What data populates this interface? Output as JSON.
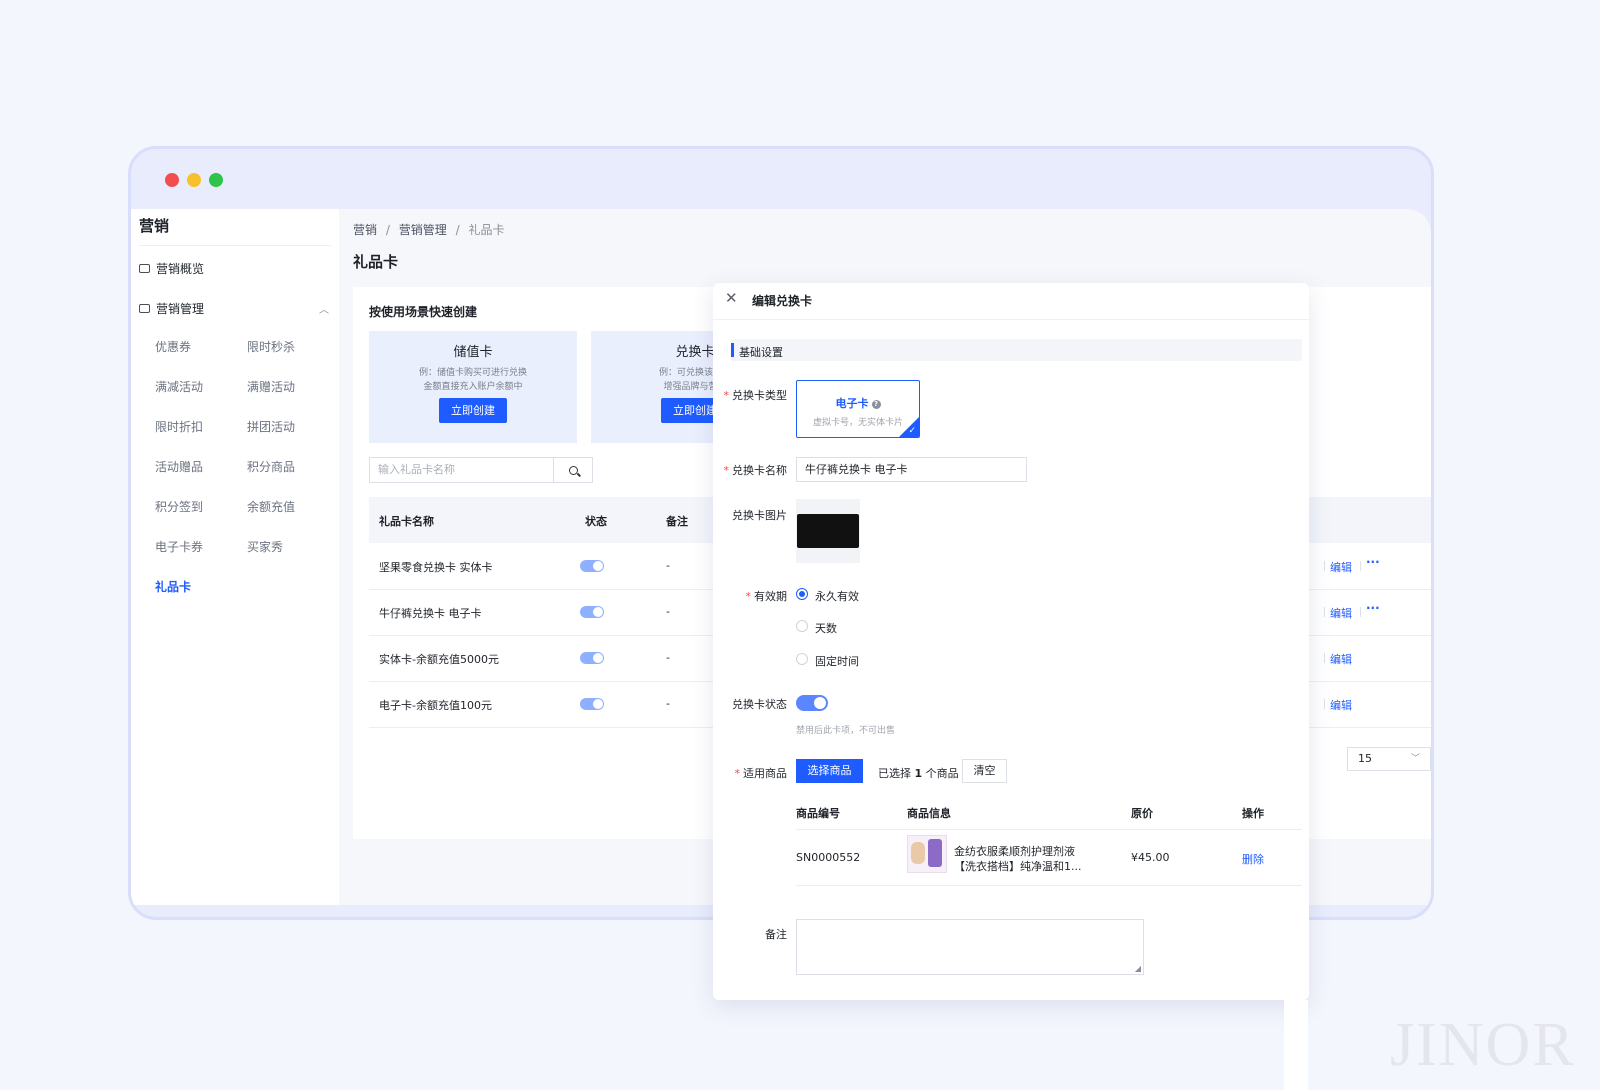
{
  "sidebar": {
    "title": "营销",
    "overview": "营销概览",
    "management": "营销管理",
    "items": [
      "优惠券",
      "限时秒杀",
      "满减活动",
      "满赠活动",
      "限时折扣",
      "拼团活动",
      "活动赠品",
      "积分商品",
      "积分签到",
      "余额充值",
      "电子卡券",
      "买家秀",
      "礼品卡"
    ],
    "active": "礼品卡"
  },
  "breadcrumb": {
    "l1": "营销",
    "l2": "营销管理",
    "l3": "礼品卡",
    "sep": "/"
  },
  "page_title": "礼品卡",
  "quick_create": {
    "title": "按使用场景快速创建",
    "cards": [
      {
        "name": "储值卡",
        "desc1": "例：储值卡购买可进行兑换",
        "desc2": "金额直接充入账户余额中",
        "button": "立即创建"
      },
      {
        "name": "兑换卡",
        "desc1": "例：可兑换该卡绑",
        "desc2": "增强品牌与营销",
        "button": "立即创建"
      }
    ]
  },
  "search": {
    "placeholder": "输入礼品卡名称"
  },
  "table": {
    "headers": {
      "name": "礼品卡名称",
      "status": "状态",
      "remark": "备注"
    },
    "rows": [
      {
        "name": "坚果零食兑换卡 实体卡",
        "remark": "-",
        "edit": "编辑",
        "more": "···"
      },
      {
        "name": "牛仔裤兑换卡 电子卡",
        "remark": "-",
        "edit": "编辑",
        "more": "···"
      },
      {
        "name": "实体卡-余额充值5000元",
        "remark": "-",
        "edit": "编辑"
      },
      {
        "name": "电子卡-余额充值100元",
        "remark": "-",
        "edit": "编辑"
      }
    ],
    "page_size": "15"
  },
  "drawer": {
    "close": "✕",
    "title": "编辑兑换卡",
    "section": "基础设置",
    "type_label": "兑换卡类型",
    "type_name": "电子卡",
    "type_help": "?",
    "type_desc": "虚拟卡号，无实体卡片",
    "type_check": "✓",
    "name_label": "兑换卡名称",
    "name_value": "牛仔裤兑换卡  电子卡",
    "image_label": "兑换卡图片",
    "validity_label": "有效期",
    "validity_options": [
      "永久有效",
      "天数",
      "固定时间"
    ],
    "status_label": "兑换卡状态",
    "status_hint": "禁用后此卡项，不可出售",
    "goods_label": "适用商品",
    "select_goods": "选择商品",
    "selected_prefix": "已选择",
    "selected_count": "1",
    "selected_suffix": "个商品",
    "clear": "清空",
    "product_table": {
      "headers": {
        "code": "商品编号",
        "info": "商品信息",
        "price": "原价",
        "action": "操作"
      },
      "row": {
        "code": "SN0000552",
        "info_line1": "金纺衣服柔顺剂护理剂液",
        "info_line2": "【洗衣搭档】纯净温和1...",
        "price": "¥45.00",
        "action": "删除"
      }
    },
    "remark_label": "备注",
    "required_mark": "*"
  },
  "watermark": "JINOR",
  "colors": {
    "accent": "#1f5cff",
    "scene_card_bg": "#e9effd",
    "window_frame": "#e8ecfc"
  }
}
